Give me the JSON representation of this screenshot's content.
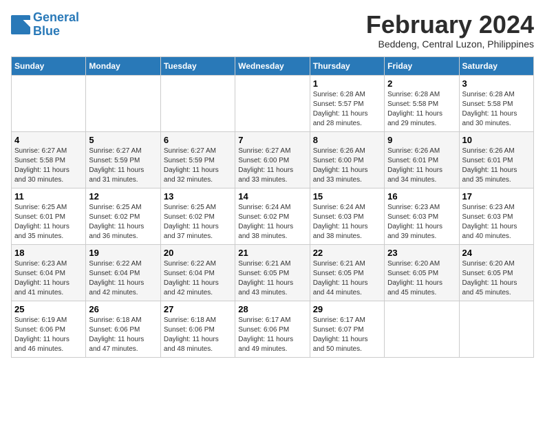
{
  "header": {
    "logo_line1": "General",
    "logo_line2": "Blue",
    "title": "February 2024",
    "subtitle": "Beddeng, Central Luzon, Philippines"
  },
  "days_of_week": [
    "Sunday",
    "Monday",
    "Tuesday",
    "Wednesday",
    "Thursday",
    "Friday",
    "Saturday"
  ],
  "weeks": [
    [
      {
        "day": "",
        "info": ""
      },
      {
        "day": "",
        "info": ""
      },
      {
        "day": "",
        "info": ""
      },
      {
        "day": "",
        "info": ""
      },
      {
        "day": "1",
        "info": "Sunrise: 6:28 AM\nSunset: 5:57 PM\nDaylight: 11 hours\nand 28 minutes."
      },
      {
        "day": "2",
        "info": "Sunrise: 6:28 AM\nSunset: 5:58 PM\nDaylight: 11 hours\nand 29 minutes."
      },
      {
        "day": "3",
        "info": "Sunrise: 6:28 AM\nSunset: 5:58 PM\nDaylight: 11 hours\nand 30 minutes."
      }
    ],
    [
      {
        "day": "4",
        "info": "Sunrise: 6:27 AM\nSunset: 5:58 PM\nDaylight: 11 hours\nand 30 minutes."
      },
      {
        "day": "5",
        "info": "Sunrise: 6:27 AM\nSunset: 5:59 PM\nDaylight: 11 hours\nand 31 minutes."
      },
      {
        "day": "6",
        "info": "Sunrise: 6:27 AM\nSunset: 5:59 PM\nDaylight: 11 hours\nand 32 minutes."
      },
      {
        "day": "7",
        "info": "Sunrise: 6:27 AM\nSunset: 6:00 PM\nDaylight: 11 hours\nand 33 minutes."
      },
      {
        "day": "8",
        "info": "Sunrise: 6:26 AM\nSunset: 6:00 PM\nDaylight: 11 hours\nand 33 minutes."
      },
      {
        "day": "9",
        "info": "Sunrise: 6:26 AM\nSunset: 6:01 PM\nDaylight: 11 hours\nand 34 minutes."
      },
      {
        "day": "10",
        "info": "Sunrise: 6:26 AM\nSunset: 6:01 PM\nDaylight: 11 hours\nand 35 minutes."
      }
    ],
    [
      {
        "day": "11",
        "info": "Sunrise: 6:25 AM\nSunset: 6:01 PM\nDaylight: 11 hours\nand 35 minutes."
      },
      {
        "day": "12",
        "info": "Sunrise: 6:25 AM\nSunset: 6:02 PM\nDaylight: 11 hours\nand 36 minutes."
      },
      {
        "day": "13",
        "info": "Sunrise: 6:25 AM\nSunset: 6:02 PM\nDaylight: 11 hours\nand 37 minutes."
      },
      {
        "day": "14",
        "info": "Sunrise: 6:24 AM\nSunset: 6:02 PM\nDaylight: 11 hours\nand 38 minutes."
      },
      {
        "day": "15",
        "info": "Sunrise: 6:24 AM\nSunset: 6:03 PM\nDaylight: 11 hours\nand 38 minutes."
      },
      {
        "day": "16",
        "info": "Sunrise: 6:23 AM\nSunset: 6:03 PM\nDaylight: 11 hours\nand 39 minutes."
      },
      {
        "day": "17",
        "info": "Sunrise: 6:23 AM\nSunset: 6:03 PM\nDaylight: 11 hours\nand 40 minutes."
      }
    ],
    [
      {
        "day": "18",
        "info": "Sunrise: 6:23 AM\nSunset: 6:04 PM\nDaylight: 11 hours\nand 41 minutes."
      },
      {
        "day": "19",
        "info": "Sunrise: 6:22 AM\nSunset: 6:04 PM\nDaylight: 11 hours\nand 42 minutes."
      },
      {
        "day": "20",
        "info": "Sunrise: 6:22 AM\nSunset: 6:04 PM\nDaylight: 11 hours\nand 42 minutes."
      },
      {
        "day": "21",
        "info": "Sunrise: 6:21 AM\nSunset: 6:05 PM\nDaylight: 11 hours\nand 43 minutes."
      },
      {
        "day": "22",
        "info": "Sunrise: 6:21 AM\nSunset: 6:05 PM\nDaylight: 11 hours\nand 44 minutes."
      },
      {
        "day": "23",
        "info": "Sunrise: 6:20 AM\nSunset: 6:05 PM\nDaylight: 11 hours\nand 45 minutes."
      },
      {
        "day": "24",
        "info": "Sunrise: 6:20 AM\nSunset: 6:05 PM\nDaylight: 11 hours\nand 45 minutes."
      }
    ],
    [
      {
        "day": "25",
        "info": "Sunrise: 6:19 AM\nSunset: 6:06 PM\nDaylight: 11 hours\nand 46 minutes."
      },
      {
        "day": "26",
        "info": "Sunrise: 6:18 AM\nSunset: 6:06 PM\nDaylight: 11 hours\nand 47 minutes."
      },
      {
        "day": "27",
        "info": "Sunrise: 6:18 AM\nSunset: 6:06 PM\nDaylight: 11 hours\nand 48 minutes."
      },
      {
        "day": "28",
        "info": "Sunrise: 6:17 AM\nSunset: 6:06 PM\nDaylight: 11 hours\nand 49 minutes."
      },
      {
        "day": "29",
        "info": "Sunrise: 6:17 AM\nSunset: 6:07 PM\nDaylight: 11 hours\nand 50 minutes."
      },
      {
        "day": "",
        "info": ""
      },
      {
        "day": "",
        "info": ""
      }
    ]
  ]
}
